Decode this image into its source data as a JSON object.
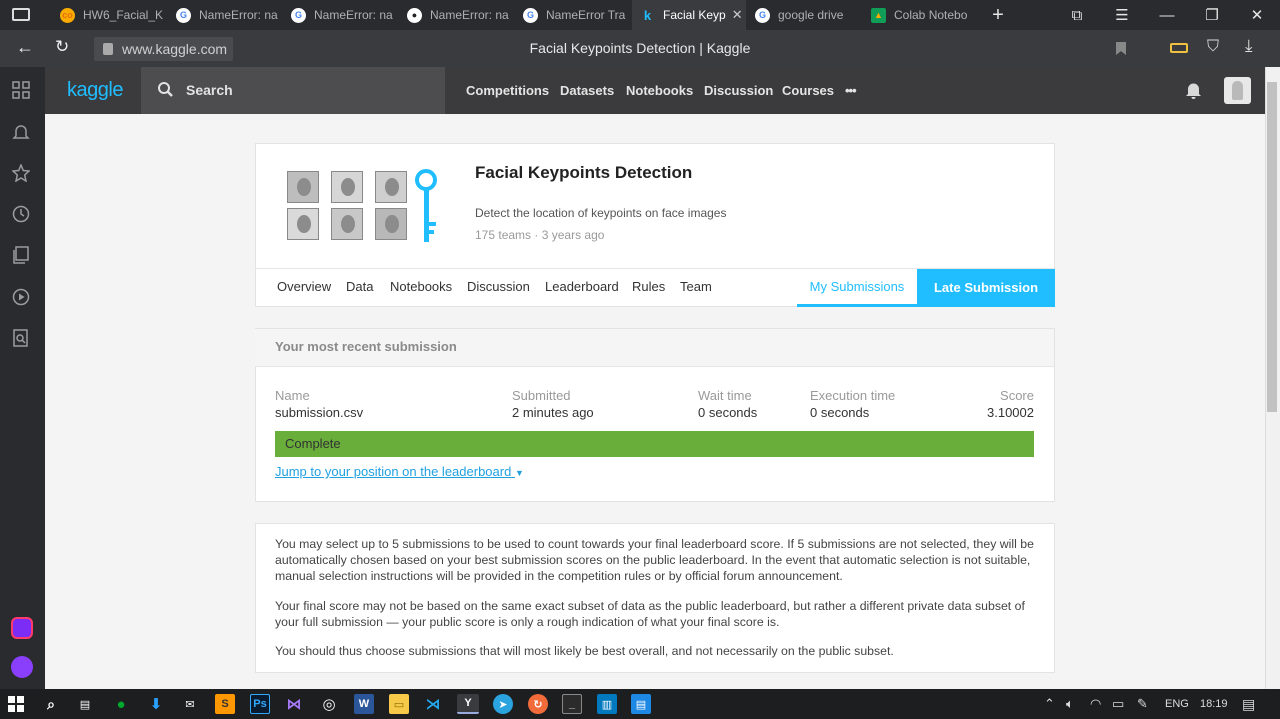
{
  "browser": {
    "tabs": [
      {
        "label": "HW6_Facial_K",
        "icon": "colab-icon",
        "color": "#f9ab00"
      },
      {
        "label": "NameError: na",
        "icon": "google-icon",
        "color": "#ffffff"
      },
      {
        "label": "NameError: na",
        "icon": "google-icon",
        "color": "#ffffff"
      },
      {
        "label": "NameError: na",
        "icon": "github-icon",
        "color": "#ffffff"
      },
      {
        "label": "NameError Tra",
        "icon": "google-icon",
        "color": "#ffffff"
      },
      {
        "label": "Facial Keyp",
        "icon": "kaggle-icon",
        "color": "#20beff",
        "active": true
      },
      {
        "label": "google drive",
        "icon": "google-icon",
        "color": "#ffffff"
      },
      {
        "label": "Colab Notebo",
        "icon": "drive-icon",
        "color": "#f9ab00"
      }
    ],
    "url": "www.kaggle.com",
    "page_title": "Facial Keypoints Detection | Kaggle"
  },
  "kaggle": {
    "logo": "kaggle",
    "search_label": "Search",
    "nav": [
      "Competitions",
      "Datasets",
      "Notebooks",
      "Discussion",
      "Courses"
    ],
    "more": "•••"
  },
  "competition": {
    "title": "Facial Keypoints Detection",
    "description": "Detect the location of keypoints on face images",
    "teams": "175 teams",
    "age": "3 years ago",
    "tabs": [
      "Overview",
      "Data",
      "Notebooks",
      "Discussion",
      "Leaderboard",
      "Rules",
      "Team"
    ],
    "my_submissions": "My Submissions",
    "late_submission": "Late Submission"
  },
  "submission": {
    "header": "Your most recent submission",
    "columns": {
      "name": {
        "label": "Name",
        "value": "submission.csv"
      },
      "submitted": {
        "label": "Submitted",
        "value": "2 minutes ago"
      },
      "wait": {
        "label": "Wait time",
        "value": "0 seconds"
      },
      "exec": {
        "label": "Execution time",
        "value": "0 seconds"
      },
      "score": {
        "label": "Score",
        "value": "3.10002"
      }
    },
    "status": "Complete",
    "jump_link": "Jump to your position on the leaderboard"
  },
  "info": {
    "p1": "You may select up to 5 submissions to be used to count towards your final leaderboard score. If 5 submissions are not selected, they will be automatically chosen based on your best submission scores on the public leaderboard. In the event that automatic selection is not suitable, manual selection instructions will be provided in the competition rules or by official forum announcement.",
    "p2": "Your final score may not be based on the same exact subset of data as the public leaderboard, but rather a different private data subset of your full submission — your public score is only a rough indication of what your final score is.",
    "p3": "You should thus choose submissions that will most likely be best overall, and not necessarily on the public subset."
  },
  "taskbar": {
    "lang": "ENG",
    "time": "18:19"
  },
  "colors": {
    "kaggle_blue": "#20beff",
    "complete_green": "#69ad3a"
  }
}
